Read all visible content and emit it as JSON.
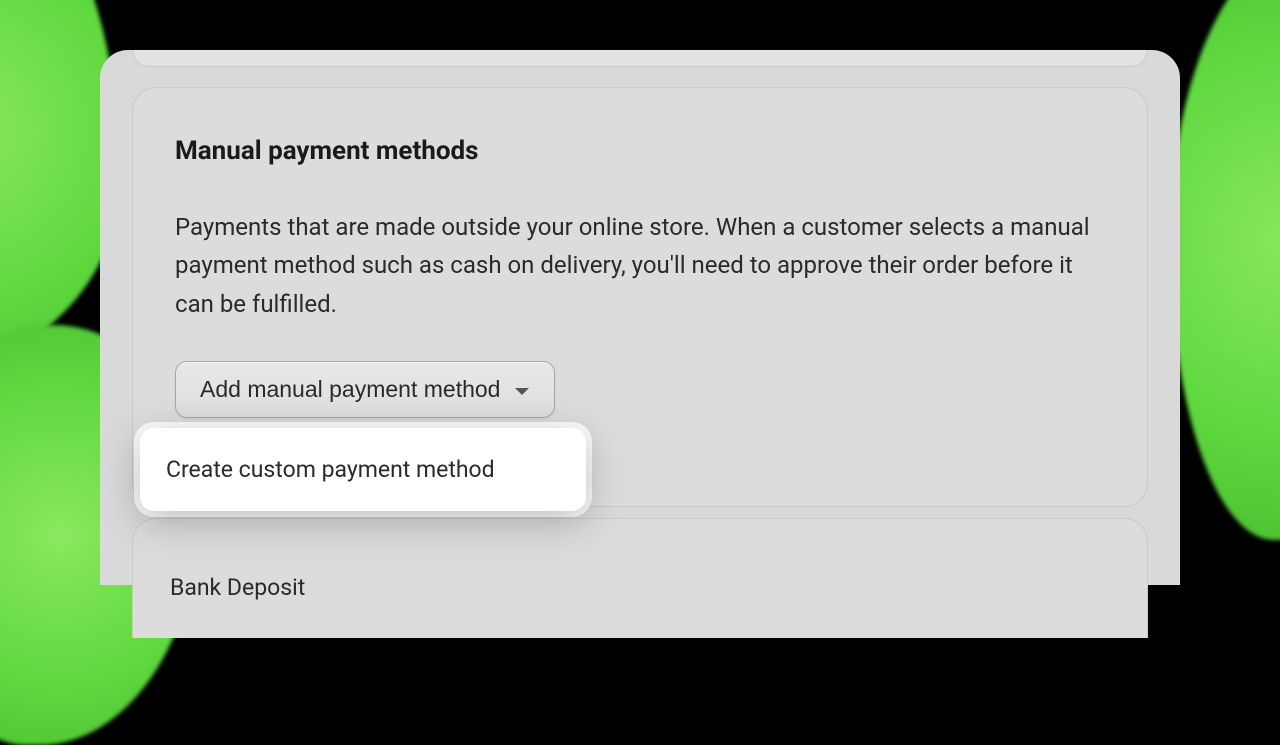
{
  "section": {
    "title": "Manual payment methods",
    "description": "Payments that are made outside your online store. When a customer selects a manual payment method such as cash on delivery, you'll need to approve their order before it can be fulfilled."
  },
  "dropdown": {
    "button_label": "Add manual payment method",
    "items": [
      {
        "label": "Create custom payment method"
      }
    ]
  },
  "partial_option": "Bank Deposit"
}
